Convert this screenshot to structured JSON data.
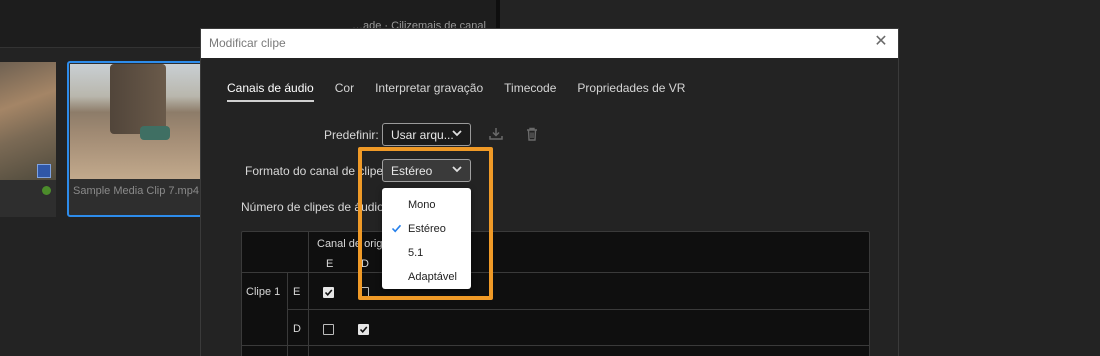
{
  "background": {
    "partial_text": "…ade · Cilizemais de canal",
    "clip2_name": "Sample Media Clip 7.mp4"
  },
  "dialog": {
    "title": "Modificar clipe",
    "close_icon": "close-icon",
    "tabs": [
      {
        "label": "Canais de áudio",
        "active": true
      },
      {
        "label": "Cor"
      },
      {
        "label": "Interpretar gravação"
      },
      {
        "label": "Timecode"
      },
      {
        "label": "Propriedades de VR"
      }
    ],
    "preset": {
      "label": "Predefinir:",
      "value": "Usar arqu...",
      "save_icon": "download-icon",
      "delete_icon": "trash-icon"
    },
    "channel_format": {
      "label": "Formato do canal de clipe:",
      "value": "Estéreo",
      "options": [
        "Mono",
        "Estéreo",
        "5.1",
        "Adaptável"
      ],
      "selected": "Estéreo"
    },
    "num_clips": {
      "label": "Número de clipes de áudio:"
    },
    "grid": {
      "header": "Canal de origem",
      "columns": [
        "E",
        "D"
      ],
      "rows": [
        {
          "clip": "Clipe 1",
          "channel": "E",
          "checks": [
            true,
            false
          ]
        },
        {
          "clip": "",
          "channel": "D",
          "checks": [
            false,
            true
          ]
        }
      ]
    }
  },
  "colors": {
    "highlight": "#f09a27",
    "selection_blue": "#2d8ceb"
  }
}
